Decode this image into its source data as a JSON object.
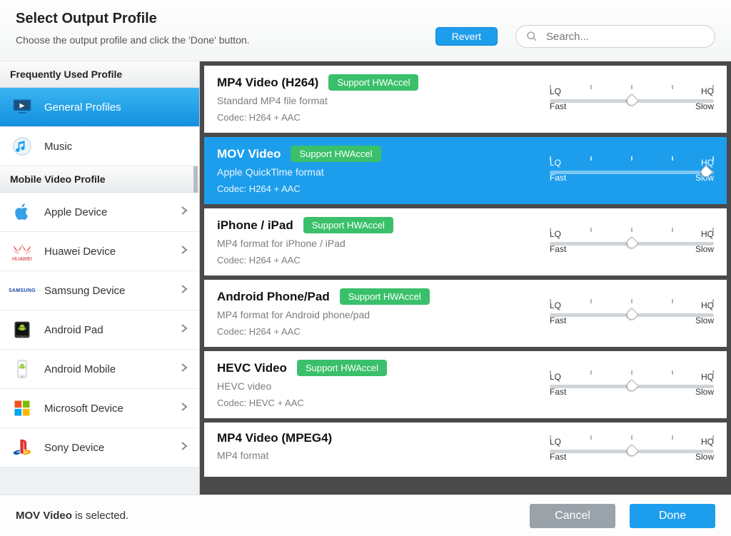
{
  "header": {
    "title": "Select Output Profile",
    "subtitle": "Choose the output profile and click the 'Done' button.",
    "revert": "Revert",
    "search_placeholder": "Search..."
  },
  "sidebar": {
    "section1": {
      "title": "Frequently Used Profile",
      "items": [
        {
          "label": "General Profiles",
          "icon": "monitor-icon",
          "selected": true
        },
        {
          "label": "Music",
          "icon": "music-icon",
          "selected": false
        }
      ]
    },
    "section2": {
      "title": "Mobile Video Profile",
      "items": [
        {
          "label": "Apple Device",
          "icon": "apple-icon"
        },
        {
          "label": "Huawei Device",
          "icon": "huawei-icon"
        },
        {
          "label": "Samsung Device",
          "icon": "samsung-icon"
        },
        {
          "label": "Android Pad",
          "icon": "android-pad-icon"
        },
        {
          "label": "Android Mobile",
          "icon": "android-mobile-icon"
        },
        {
          "label": "Microsoft Device",
          "icon": "microsoft-icon"
        },
        {
          "label": "Sony Device",
          "icon": "playstation-icon"
        }
      ]
    }
  },
  "slider_labels": {
    "lq": "LQ",
    "hq": "HQ",
    "fast": "Fast",
    "slow": "Slow"
  },
  "badge_text": "Support HWAccel",
  "profiles": [
    {
      "title": "MP4 Video (H264)",
      "badge": true,
      "sub": "Standard MP4 file format",
      "codec": "Codec: H264 + AAC",
      "selected": false,
      "thumb": 50
    },
    {
      "title": "MOV Video",
      "badge": true,
      "sub": "Apple QuickTime format",
      "codec": "Codec: H264 + AAC",
      "selected": true,
      "thumb": 95
    },
    {
      "title": "iPhone / iPad",
      "badge": true,
      "sub": "MP4 format for iPhone / iPad",
      "codec": "Codec: H264 + AAC",
      "selected": false,
      "thumb": 50
    },
    {
      "title": "Android Phone/Pad",
      "badge": true,
      "sub": "MP4 format for Android phone/pad",
      "codec": "Codec: H264 + AAC",
      "selected": false,
      "thumb": 50
    },
    {
      "title": "HEVC Video",
      "badge": true,
      "sub": "HEVC video",
      "codec": "Codec: HEVC + AAC",
      "selected": false,
      "thumb": 50
    },
    {
      "title": "MP4 Video (MPEG4)",
      "badge": false,
      "sub": "MP4 format",
      "codec": "",
      "selected": false,
      "thumb": 50
    }
  ],
  "footer": {
    "status_prefix": "MOV Video",
    "status_suffix": " is selected.",
    "cancel": "Cancel",
    "done": "Done"
  },
  "brand_text": {
    "huawei": "HUAWEI",
    "samsung": "SAMSUNG"
  }
}
